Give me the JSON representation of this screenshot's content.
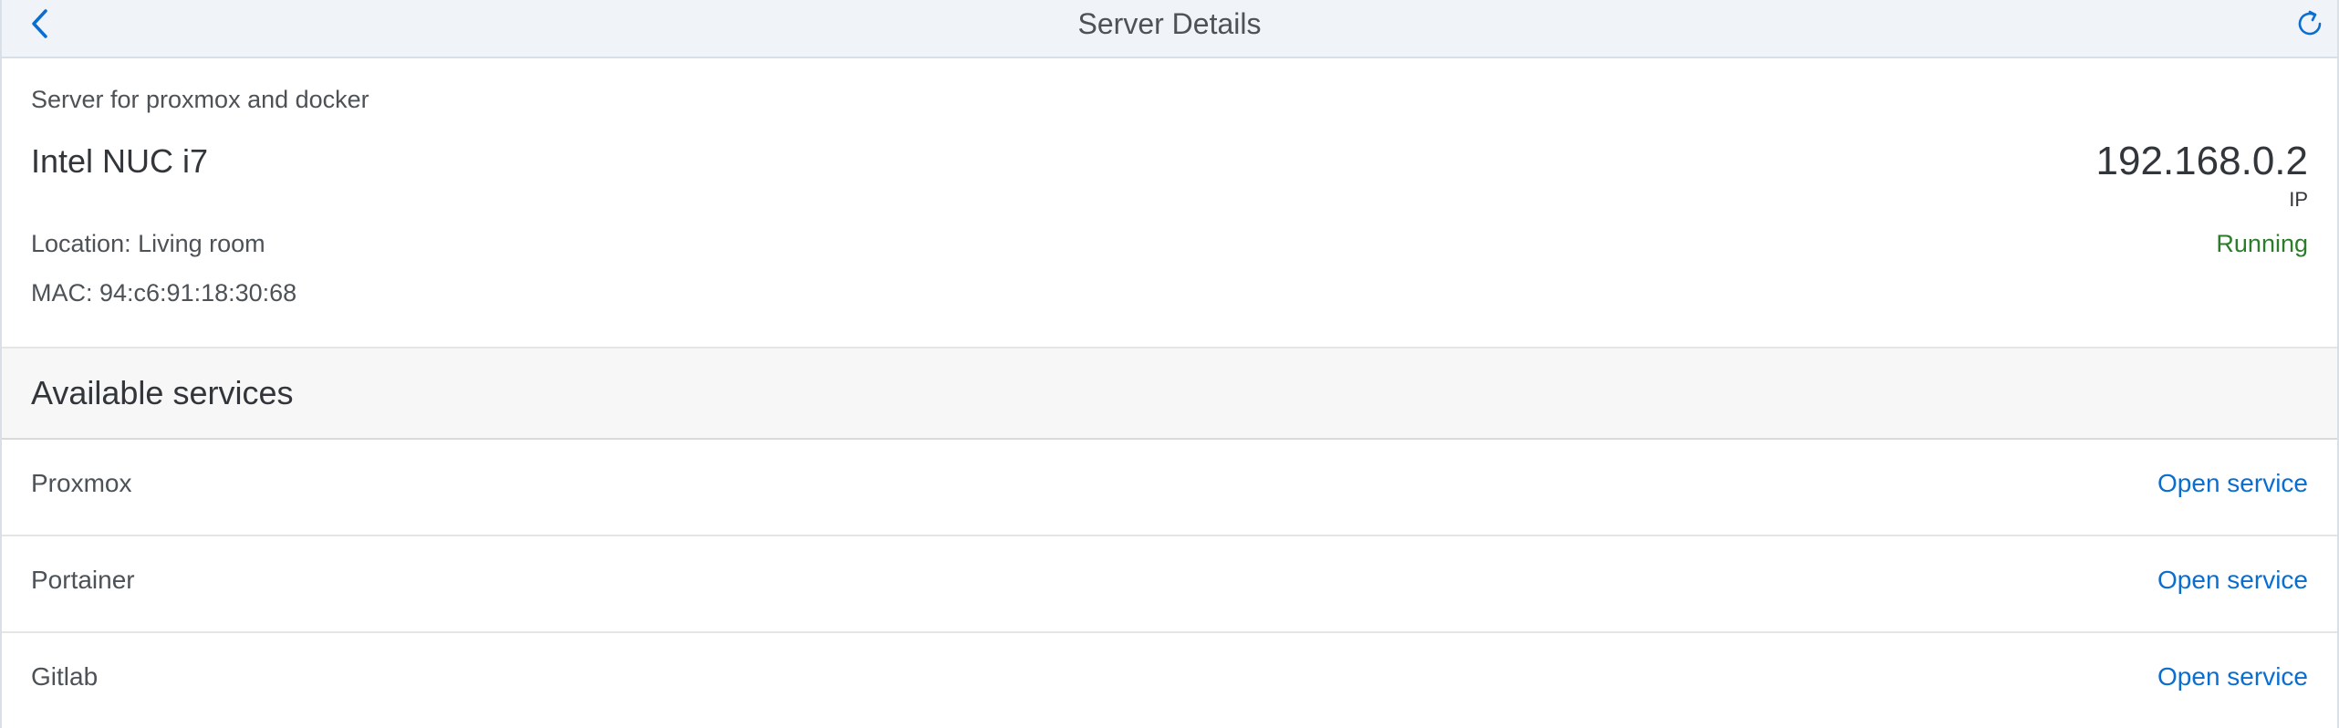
{
  "header": {
    "title": "Server Details",
    "back_icon": "chevron-left-icon",
    "refresh_icon": "refresh-icon"
  },
  "object": {
    "intro": "Server for proxmox and docker",
    "title": "Intel NUC i7",
    "number": "192.168.0.2",
    "unit": "IP",
    "location": "Location: Living room",
    "mac": "MAC: 94:c6:91:18:30:68",
    "status": "Running",
    "status_color": "#2b7c2b"
  },
  "services": {
    "title": "Available services",
    "items": [
      {
        "name": "Proxmox",
        "action": "Open service"
      },
      {
        "name": "Portainer",
        "action": "Open service"
      },
      {
        "name": "Gitlab",
        "action": "Open service"
      }
    ]
  },
  "colors": {
    "accent": "#0a6ed1",
    "header_bg": "#f0f3f8"
  }
}
